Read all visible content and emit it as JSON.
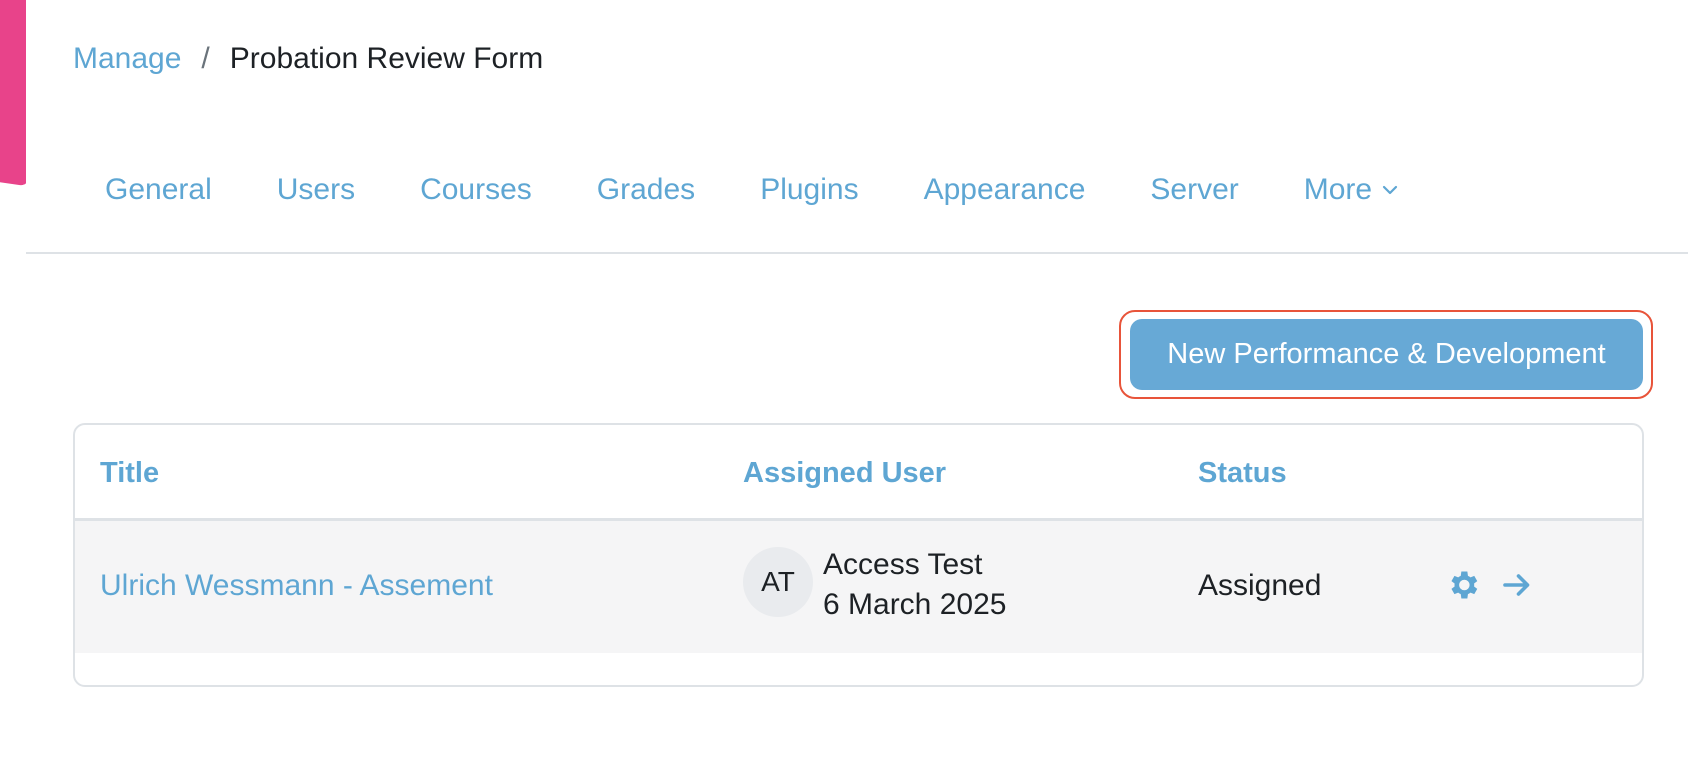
{
  "breadcrumb": {
    "parent_label": "Manage",
    "separator": "/",
    "current_label": "Probation Review Form"
  },
  "nav": {
    "items": [
      {
        "label": "General"
      },
      {
        "label": "Users"
      },
      {
        "label": "Courses"
      },
      {
        "label": "Grades"
      },
      {
        "label": "Plugins"
      },
      {
        "label": "Appearance"
      },
      {
        "label": "Server"
      },
      {
        "label": "More",
        "icon": "chevron-down-icon"
      }
    ]
  },
  "actions": {
    "new_button_label": "New Performance & Development"
  },
  "table": {
    "columns": [
      "Title",
      "Assigned User",
      "Status"
    ],
    "rows": [
      {
        "title": "Ulrich Wessmann - Assement",
        "avatar_initials": "AT",
        "user_name": "Access Test",
        "date": "6 March 2025",
        "status": "Assigned",
        "action_icons": [
          "gear-icon",
          "arrow-right-icon"
        ]
      }
    ]
  },
  "colors": {
    "accent": "#e8438a",
    "link": "#5ea6d3",
    "primary_button": "#67a9d6",
    "focus_outline": "#e8543a"
  }
}
